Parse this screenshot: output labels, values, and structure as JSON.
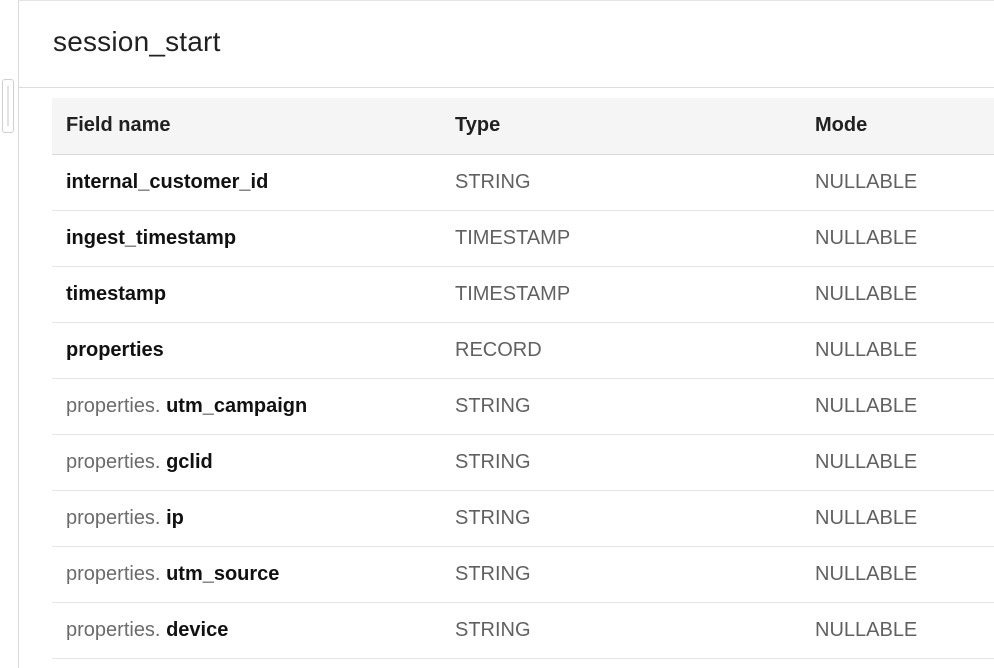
{
  "page": {
    "title": "session_start"
  },
  "table": {
    "headers": {
      "field_name": "Field name",
      "type": "Type",
      "mode": "Mode"
    },
    "rows": [
      {
        "prefix": "",
        "name": "internal_customer_id",
        "type": "STRING",
        "mode": "NULLABLE"
      },
      {
        "prefix": "",
        "name": "ingest_timestamp",
        "type": "TIMESTAMP",
        "mode": "NULLABLE"
      },
      {
        "prefix": "",
        "name": "timestamp",
        "type": "TIMESTAMP",
        "mode": "NULLABLE"
      },
      {
        "prefix": "",
        "name": "properties",
        "type": "RECORD",
        "mode": "NULLABLE"
      },
      {
        "prefix": "properties. ",
        "name": "utm_campaign",
        "type": "STRING",
        "mode": "NULLABLE"
      },
      {
        "prefix": "properties. ",
        "name": "gclid",
        "type": "STRING",
        "mode": "NULLABLE"
      },
      {
        "prefix": "properties. ",
        "name": "ip",
        "type": "STRING",
        "mode": "NULLABLE"
      },
      {
        "prefix": "properties. ",
        "name": "utm_source",
        "type": "STRING",
        "mode": "NULLABLE"
      },
      {
        "prefix": "properties. ",
        "name": "device",
        "type": "STRING",
        "mode": "NULLABLE"
      }
    ]
  }
}
